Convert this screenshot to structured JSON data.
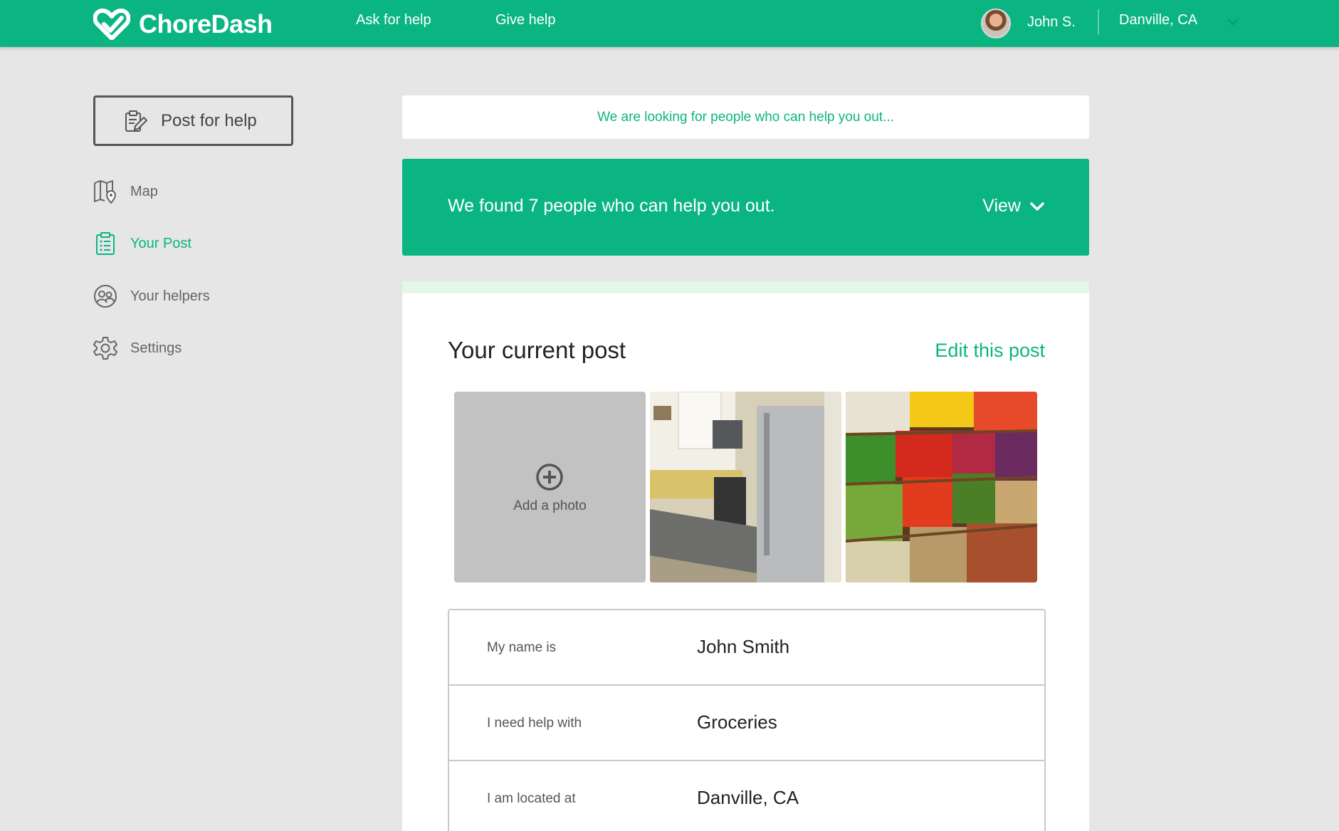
{
  "header": {
    "brand": "ChoreDash",
    "nav": [
      {
        "label": "Ask for help"
      },
      {
        "label": "Give help"
      }
    ],
    "user_name": "John S.",
    "location": "Danville, CA",
    "accent_color": "#0bb582"
  },
  "sidebar": {
    "post_button_label": "Post for help",
    "items": [
      {
        "label": "Map",
        "icon": "map-icon",
        "active": false
      },
      {
        "label": "Your Post",
        "icon": "clipboard-list-icon",
        "active": true
      },
      {
        "label": "Your helpers",
        "icon": "people-icon",
        "active": false
      },
      {
        "label": "Settings",
        "icon": "gear-icon",
        "active": false
      }
    ]
  },
  "main": {
    "searching_text": "We are looking for people who can help you out...",
    "found_text": "We found 7 people who can help you out.",
    "view_label": "View",
    "card": {
      "title": "Your current post",
      "edit_label": "Edit this post",
      "add_photo_label": "Add a photo",
      "rows": [
        {
          "label": "My name is",
          "value": "John Smith"
        },
        {
          "label": "I need help with",
          "value": "Groceries"
        },
        {
          "label": "I am located at",
          "value": "Danville, CA"
        }
      ]
    }
  }
}
